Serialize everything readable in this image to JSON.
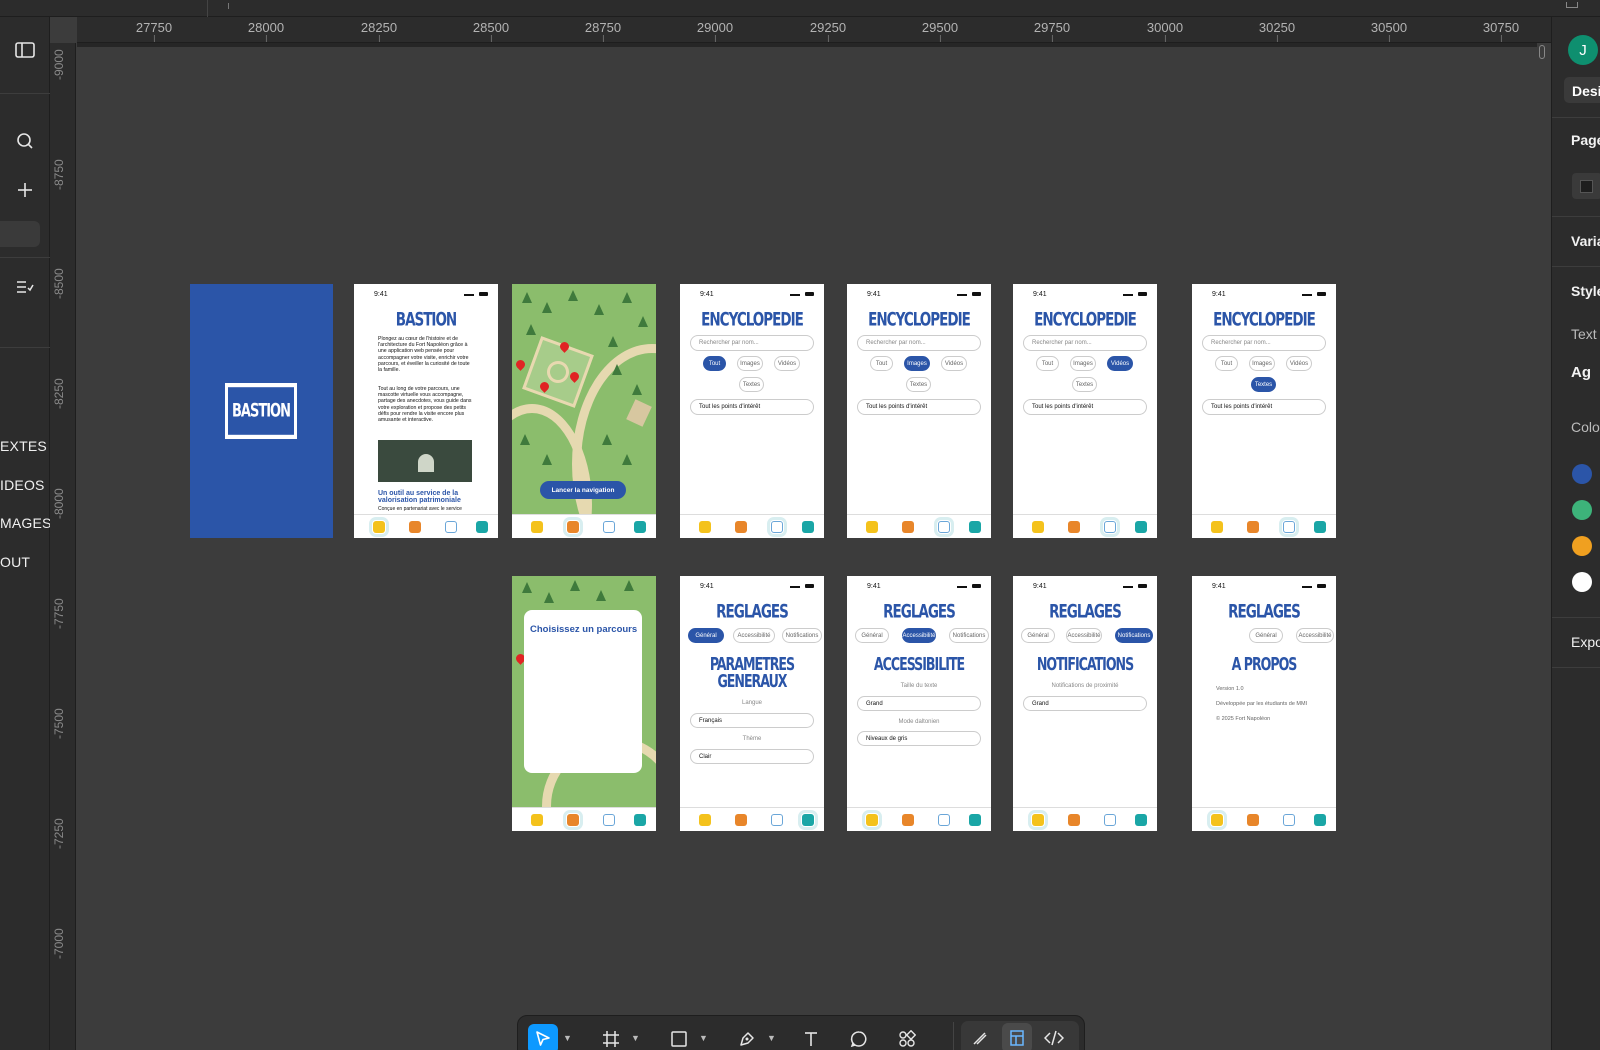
{
  "rulers": {
    "horizontal": [
      "27750",
      "28000",
      "28250",
      "28500",
      "28750",
      "29000",
      "29250",
      "29500",
      "29750",
      "30000",
      "30250",
      "30500",
      "30750"
    ],
    "vertical": [
      "-9000",
      "-8750",
      "-8500",
      "-8250",
      "-8000",
      "-7750",
      "-7500",
      "-7250",
      "-7000"
    ]
  },
  "left_panel": {
    "labels": [
      "EXTES",
      "IDEOS",
      "MAGES",
      "OUT"
    ]
  },
  "right_panel": {
    "avatar_letter": "J",
    "design_tab": "Desi",
    "page": "Page",
    "variables": "Varia",
    "styles": "Style",
    "text": "Text",
    "ag": "Ag",
    "color": "Colo",
    "export": "Expo",
    "colors": [
      "#2b55a8",
      "#3db37a",
      "#f0a020",
      "#ffffff"
    ]
  },
  "app": {
    "logo_text": "BASTION",
    "status_time": "9:41",
    "home": {
      "title": "BASTION",
      "para1": "Plongez au cœur de l'histoire et de l'architecture du Fort Napoléon grâce à une application web pensée pour accompagner votre visite, enrichir votre parcours, et éveiller la curiosité de toute la famille.",
      "para2": "Tout au long de votre parcours, une mascotte virtuelle vous accompagne, partage des anecdotes, vous guide dans votre exploration et propose des petits défis pour rendre la visite encore plus amusante et interactive.",
      "subtitle": "Un outil au service de la valorisation patrimoniale",
      "footer": "Conçue en partenariat avec le service"
    },
    "map": {
      "cta": "Lancer la navigation",
      "choose_title": "Choisissez un parcours"
    },
    "encyclopedia": {
      "title": "ENCYCLOPEDIE",
      "search_placeholder": "Rechercher par nom...",
      "chips": [
        "Tout",
        "Images",
        "Vidéos",
        "Textes"
      ],
      "poi": "Tout les points d'intérêt"
    },
    "settings": {
      "title": "REGLAGES",
      "tabs": [
        "Général",
        "Accessibilité",
        "Notifications"
      ],
      "general": {
        "title_l1": "PARAMETRES",
        "title_l2": "GENERAUX",
        "lang_label": "Langue",
        "lang_value": "Français",
        "theme_label": "Thème",
        "theme_value": "Clair"
      },
      "accessibility": {
        "title": "ACCESSIBILITE",
        "text_size_label": "Taille du texte",
        "text_size_value": "Grand",
        "color_mode_label": "Mode daltonien",
        "color_mode_value": "Niveaux de gris"
      },
      "notifications": {
        "title": "NOTIFICATIONS",
        "proximity_label": "Notifications de proximité",
        "proximity_value": "Grand"
      },
      "about": {
        "title": "A PROPOS",
        "version": "Version 1.0",
        "dev": "Développée par les étudiants de MMI",
        "copyright": "© 2025 Fort Napoléon"
      }
    }
  }
}
